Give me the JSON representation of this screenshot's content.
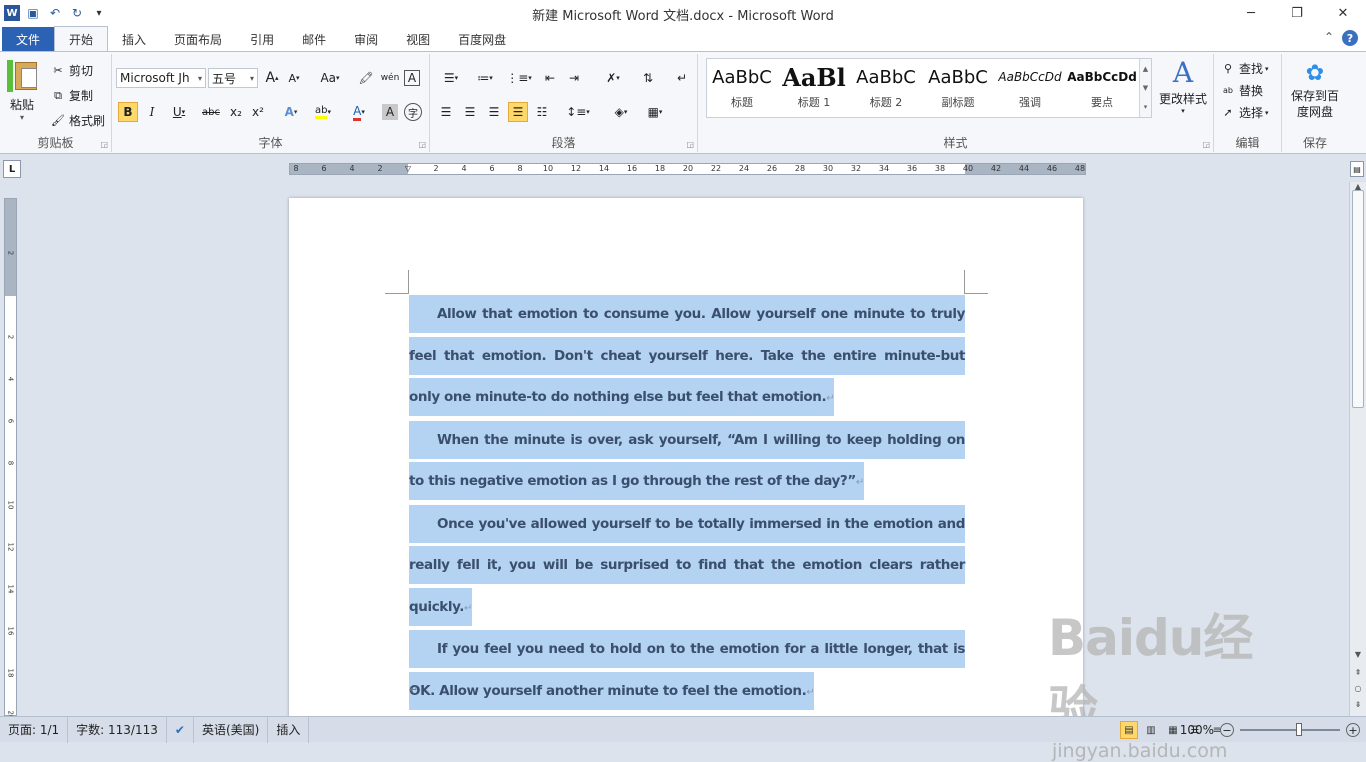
{
  "window": {
    "title": "新建 Microsoft Word 文档.docx  -  Microsoft Word",
    "minimize": "─",
    "restore": "❐",
    "close": "✕"
  },
  "qat": {
    "app_icon": "W",
    "save": "💾",
    "undo": "↶",
    "redo": "↻",
    "customize": "▾"
  },
  "tabs": [
    "文件",
    "开始",
    "插入",
    "页面布局",
    "引用",
    "邮件",
    "审阅",
    "视图",
    "百度网盘"
  ],
  "ribbon": {
    "clipboard": {
      "label": "剪贴板",
      "paste": "粘贴",
      "cut": "剪切",
      "copy": "复制",
      "format_painter": "格式刷"
    },
    "font": {
      "label": "字体",
      "font_name": "Microsoft Jh",
      "font_size": "五号",
      "grow": "A",
      "shrink": "A",
      "change_case": "Aa",
      "clear": "A",
      "bold": "B",
      "italic": "I",
      "underline": "U",
      "strike": "abc",
      "sub": "x₂",
      "sup": "x²",
      "effects": "A",
      "highlight": "ab",
      "font_color": "A",
      "char_shading": "A",
      "enclose": "字"
    },
    "paragraph": {
      "label": "段落"
    },
    "styles": {
      "label": "样式",
      "items": [
        {
          "preview": "AaBbC",
          "name": "标题"
        },
        {
          "preview": "AaBl",
          "name": "标题 1"
        },
        {
          "preview": "AaBbC",
          "name": "标题 2"
        },
        {
          "preview": "AaBbC",
          "name": "副标题"
        },
        {
          "preview": "AaBbCcDd",
          "name": "强调"
        },
        {
          "preview": "AaBbCcDd",
          "name": "要点"
        }
      ],
      "change_styles": "更改样式"
    },
    "editing": {
      "label": "编辑",
      "find": "查找",
      "replace": "替换",
      "select": "选择"
    },
    "save": {
      "label": "保存",
      "save_baidu": "保存到百度网盘"
    }
  },
  "ruler": {
    "corner": "L",
    "numbers": [
      "8",
      "6",
      "4",
      "2",
      "",
      "2",
      "4",
      "6",
      "8",
      "10",
      "12",
      "14",
      "16",
      "18",
      "20",
      "22",
      "24",
      "26",
      "28",
      "30",
      "32",
      "34",
      "36",
      "38",
      "40",
      "42",
      "44",
      "46",
      "48"
    ]
  },
  "vruler": {
    "numbers": [
      "2",
      "",
      "2",
      "4",
      "6",
      "8",
      "10",
      "12",
      "14",
      "16",
      "18",
      "20"
    ]
  },
  "document": {
    "paragraphs": [
      "Allow that emotion to consume you. Allow yourself one minute to truly feel that emotion. Don't cheat yourself here. Take the entire minute-but only one minute-to do nothing else but feel that emotion.",
      "When the minute is over, ask yourself, “Am I willing to keep holding on to this negative emotion as I go through the rest of the day?”",
      "Once you've allowed yourself to be totally immersed in the emotion and really fell it, you will be surprised to find that the emotion clears rather quickly.",
      "If you feel you need to hold on to the emotion for a little longer, that is OK. Allow yourself another minute to feel the emotion."
    ],
    "para_mark": "↵"
  },
  "status": {
    "page": "页面: 1/1",
    "words": "字数: 113/113",
    "language": "英语(美国)",
    "mode": "插入",
    "zoom": "100%"
  },
  "watermark": {
    "logo": "Baidu经验",
    "url": "jingyan.baidu.com"
  }
}
